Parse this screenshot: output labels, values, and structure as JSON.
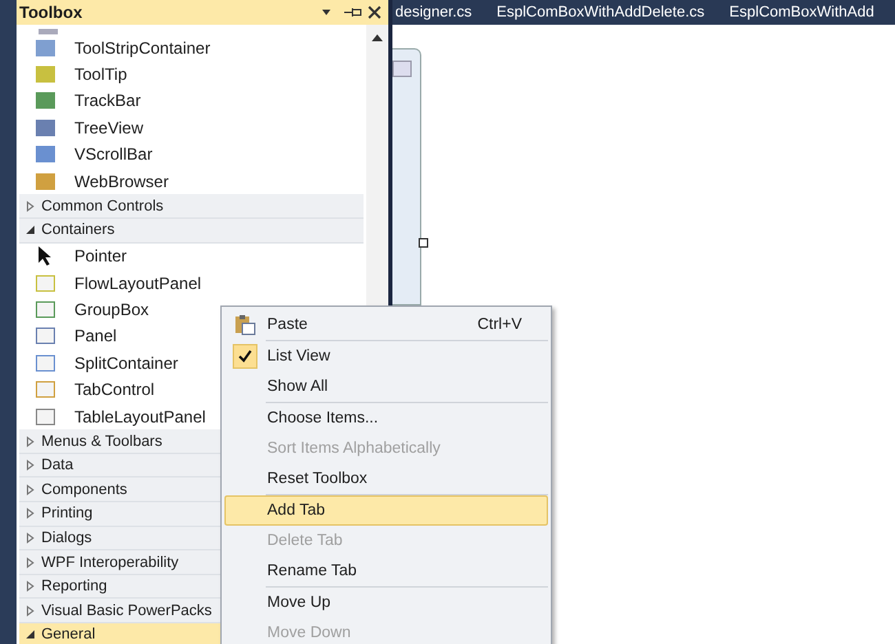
{
  "toolbox": {
    "title": "Toolbox",
    "top_items": [
      {
        "label": "ToolStripContainer"
      },
      {
        "label": "ToolTip"
      },
      {
        "label": "TrackBar"
      },
      {
        "label": "TreeView"
      },
      {
        "label": "VScrollBar"
      },
      {
        "label": "WebBrowser"
      }
    ],
    "categories": [
      {
        "label": "Common Controls",
        "expanded": false,
        "selected": false
      },
      {
        "label": "Containers",
        "expanded": true,
        "selected": false,
        "items": [
          {
            "label": "Pointer"
          },
          {
            "label": "FlowLayoutPanel"
          },
          {
            "label": "GroupBox"
          },
          {
            "label": "Panel"
          },
          {
            "label": "SplitContainer"
          },
          {
            "label": "TabControl"
          },
          {
            "label": "TableLayoutPanel"
          }
        ]
      },
      {
        "label": "Menus & Toolbars",
        "expanded": false,
        "selected": false
      },
      {
        "label": "Data",
        "expanded": false,
        "selected": false
      },
      {
        "label": "Components",
        "expanded": false,
        "selected": false
      },
      {
        "label": "Printing",
        "expanded": false,
        "selected": false
      },
      {
        "label": "Dialogs",
        "expanded": false,
        "selected": false
      },
      {
        "label": "WPF Interoperability",
        "expanded": false,
        "selected": false
      },
      {
        "label": "Reporting",
        "expanded": false,
        "selected": false
      },
      {
        "label": "Visual Basic PowerPacks",
        "expanded": false,
        "selected": false
      },
      {
        "label": "General",
        "expanded": true,
        "selected": true
      }
    ]
  },
  "document_tabs": [
    {
      "label": "designer.cs"
    },
    {
      "label": "EsplComBoxWithAddDelete.cs"
    },
    {
      "label": "EsplComBoxWithAdd"
    }
  ],
  "context_menu": [
    {
      "kind": "item",
      "label": "Paste",
      "shortcut": "Ctrl+V",
      "disabled": false,
      "checked": false,
      "selected": false,
      "icon": true
    },
    {
      "kind": "separator"
    },
    {
      "kind": "item",
      "label": "List View",
      "disabled": false,
      "checked": true,
      "selected": false
    },
    {
      "kind": "item",
      "label": "Show All",
      "disabled": false,
      "checked": false,
      "selected": false
    },
    {
      "kind": "separator"
    },
    {
      "kind": "item",
      "label": "Choose Items...",
      "disabled": false,
      "checked": false,
      "selected": false
    },
    {
      "kind": "item",
      "label": "Sort Items Alphabetically",
      "disabled": true,
      "checked": false,
      "selected": false
    },
    {
      "kind": "item",
      "label": "Reset Toolbox",
      "disabled": false,
      "checked": false,
      "selected": false
    },
    {
      "kind": "separator"
    },
    {
      "kind": "item",
      "label": "Add Tab",
      "disabled": false,
      "checked": false,
      "selected": true
    },
    {
      "kind": "item",
      "label": "Delete Tab",
      "disabled": true,
      "checked": false,
      "selected": false
    },
    {
      "kind": "item",
      "label": "Rename Tab",
      "disabled": false,
      "checked": false,
      "selected": false
    },
    {
      "kind": "separator"
    },
    {
      "kind": "item",
      "label": "Move Up",
      "disabled": false,
      "checked": false,
      "selected": false
    },
    {
      "kind": "item",
      "label": "Move Down",
      "disabled": true,
      "checked": false,
      "selected": false
    }
  ]
}
